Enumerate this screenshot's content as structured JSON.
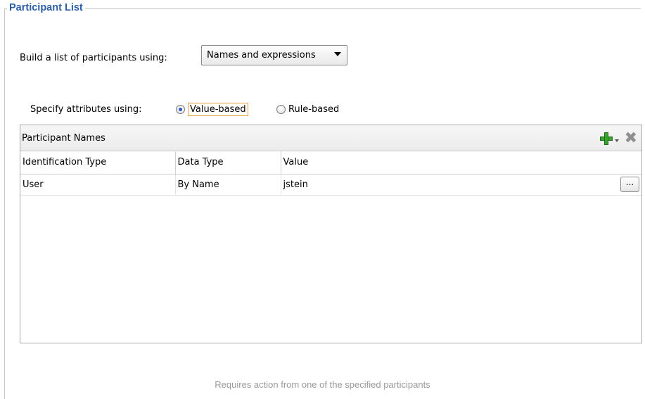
{
  "frame": {
    "title": "Participant List"
  },
  "build": {
    "label": "Build a list of participants using:",
    "dropdown_value": "Names and expressions"
  },
  "attributes": {
    "label": "Specify attributes using:",
    "options": [
      {
        "label": "Value-based",
        "checked": true
      },
      {
        "label": "Rule-based",
        "checked": false
      }
    ]
  },
  "panel": {
    "title": "Participant Names",
    "toolbar": {
      "add_icon": "add-icon",
      "delete_icon": "delete-icon"
    },
    "columns": [
      "Identification Type",
      "Data Type",
      "Value"
    ],
    "rows": [
      {
        "identification_type": "User",
        "data_type": "By Name",
        "value": "jstein",
        "browse_label": "..."
      }
    ]
  },
  "footer": {
    "note": "Requires action from one of the specified participants"
  },
  "colors": {
    "title": "#2b5ea7",
    "focus": "#e5a03a",
    "add_green": "#3aa12f"
  }
}
